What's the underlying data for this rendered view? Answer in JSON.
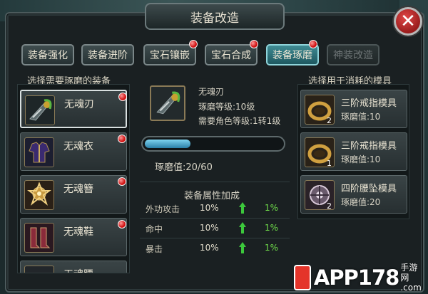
{
  "title": "装备改造",
  "tabs": [
    {
      "label": "装备强化",
      "badge": false,
      "state": "normal"
    },
    {
      "label": "装备进阶",
      "badge": false,
      "state": "normal"
    },
    {
      "label": "宝石镶嵌",
      "badge": true,
      "state": "normal"
    },
    {
      "label": "宝石合成",
      "badge": true,
      "state": "normal"
    },
    {
      "label": "装备琢磨",
      "badge": true,
      "state": "active"
    },
    {
      "label": "神装改造",
      "badge": false,
      "state": "disabled"
    }
  ],
  "left_panel": {
    "header": "选择需要琢磨的装备",
    "items": [
      {
        "name": "无魂刃",
        "icon": "blade-icon",
        "selected": true,
        "badge": true
      },
      {
        "name": "无魂衣",
        "icon": "armor-icon",
        "selected": false,
        "badge": true
      },
      {
        "name": "无魂簪",
        "icon": "hairpin-icon",
        "selected": false,
        "badge": true
      },
      {
        "name": "无魂鞋",
        "icon": "boots-icon",
        "selected": false,
        "badge": true
      },
      {
        "name": "无魂腰",
        "icon": "belt-icon",
        "selected": false,
        "badge": false
      }
    ]
  },
  "center": {
    "item_name": "无魂刃",
    "polish_level": "琢磨等级:10级",
    "required_level": "需要角色等级:1转1级",
    "progress_text": "琢磨值:20/60",
    "progress_fraction": 0.333,
    "attr_header": "装备属性加成",
    "attributes": [
      {
        "name": "外功攻击",
        "base": "10%",
        "bonus": "1%"
      },
      {
        "name": "命中",
        "base": "10%",
        "bonus": "1%"
      },
      {
        "name": "暴击",
        "base": "10%",
        "bonus": "1%"
      }
    ]
  },
  "right_panel": {
    "header": "选择用于消耗的模具",
    "molds": [
      {
        "name": "三阶戒指模具",
        "value": "琢磨值:10",
        "count": "2",
        "icon": "ring-icon"
      },
      {
        "name": "三阶戒指模具",
        "value": "琢磨值:10",
        "count": "1",
        "icon": "ring-icon"
      },
      {
        "name": "四阶腰坠模具",
        "value": "琢磨值:20",
        "count": "2",
        "icon": "pendant-icon"
      }
    ]
  },
  "watermark": {
    "main": "APP178",
    "side_top": "手游网",
    "side_bottom": ".com"
  },
  "colors": {
    "active_tab": "#2e7880",
    "bonus_green": "#6fdc4a",
    "close_red": "#c02a2a"
  }
}
